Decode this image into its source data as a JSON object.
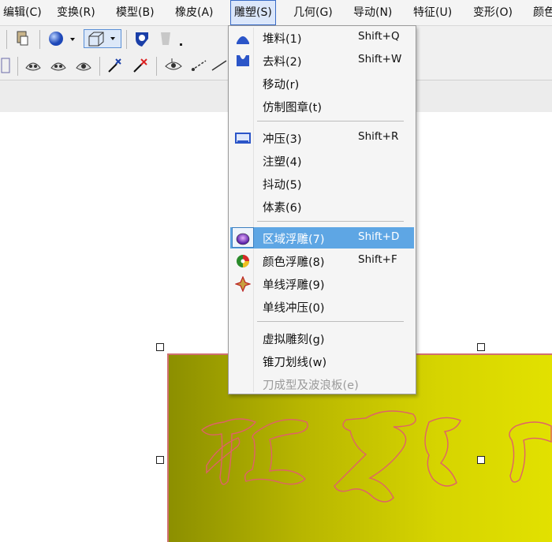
{
  "menubar": {
    "items": [
      {
        "label": "编辑(C)",
        "active": false
      },
      {
        "label": "变换(R)",
        "active": false
      },
      {
        "label": "模型(B)",
        "active": false
      },
      {
        "label": "橡皮(A)",
        "active": false
      },
      {
        "label": "雕塑(S)",
        "active": true
      },
      {
        "label": "几何(G)",
        "active": false
      },
      {
        "label": "导动(N)",
        "active": false
      },
      {
        "label": "特征(U)",
        "active": false
      },
      {
        "label": "变形(O)",
        "active": false
      },
      {
        "label": "颜色",
        "active": false
      }
    ]
  },
  "dropdown": {
    "items": [
      {
        "label": "堆料(1)",
        "shortcut": "Shift+Q",
        "icon": "pile-icon"
      },
      {
        "label": "去料(2)",
        "shortcut": "Shift+W",
        "icon": "remove-material-icon"
      },
      {
        "label": "移动(r)",
        "shortcut": "",
        "icon": ""
      },
      {
        "label": "仿制图章(t)",
        "shortcut": "",
        "icon": ""
      },
      {
        "label": "冲压(3)",
        "shortcut": "Shift+R",
        "icon": "stamp-icon"
      },
      {
        "label": "注塑(4)",
        "shortcut": "",
        "icon": ""
      },
      {
        "label": "抖动(5)",
        "shortcut": "",
        "icon": ""
      },
      {
        "label": "体素(6)",
        "shortcut": "",
        "icon": ""
      },
      {
        "label": "区域浮雕(7)",
        "shortcut": "Shift+D",
        "icon": "area-relief-icon",
        "highlighted": true
      },
      {
        "label": "颜色浮雕(8)",
        "shortcut": "Shift+F",
        "icon": "color-relief-icon"
      },
      {
        "label": "单线浮雕(9)",
        "shortcut": "",
        "icon": "line-relief-icon"
      },
      {
        "label": "单线冲压(0)",
        "shortcut": "",
        "icon": ""
      },
      {
        "label": "虚拟雕刻(g)",
        "shortcut": "",
        "icon": ""
      },
      {
        "label": "锥刀划线(w)",
        "shortcut": "",
        "icon": ""
      },
      {
        "label": "刀成型及波浪板(e)",
        "shortcut": "",
        "icon": "",
        "disabled": true
      }
    ]
  },
  "canvas": {
    "plate_colors": {
      "left": "#8c8f00",
      "right": "#e2e100",
      "outline": "#e0606a"
    },
    "handles": [
      "top-left",
      "top-center",
      "middle-left",
      "center"
    ]
  },
  "colors": {
    "highlight": "#5ea6e4",
    "menubar_bg": "#f4f4f4",
    "menu_bg": "#f5f5f5"
  }
}
